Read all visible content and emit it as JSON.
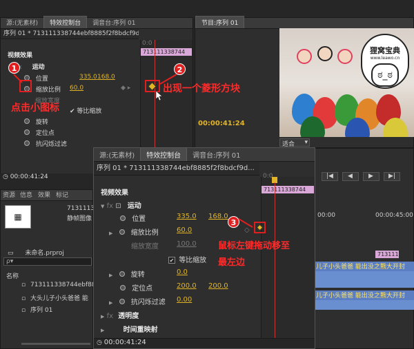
{
  "back_panel": {
    "tabs": [
      "源:(无素材)",
      "特效控制台",
      "调音台:序列 01"
    ],
    "sequence_header": "序列 01 * 713111338744ebf8885f2f8bdcf9d...",
    "section_title": "视频效果",
    "motion": "运动",
    "position_label": "位置",
    "position_x": "335.0",
    "position_y": "168.0",
    "scale_label": "缩放比例",
    "scale_value": "60.0",
    "scale_width_label": "缩放宽度",
    "uniform_scale": "等比缩放",
    "rotation_label": "旋转",
    "anchor_label": "定位点",
    "anti_flicker_label": "抗闪烁过滤",
    "clip_name": "713111338744",
    "timecode": "00:00:41:24",
    "ruler_start": "0:0"
  },
  "program_monitor": {
    "tabs": [
      "节目:序列 01"
    ],
    "timecode": "00:00:41:24",
    "fit_label": "适合",
    "watermark_title": "狸窝宝典",
    "watermark_url": "www.leawo.cn"
  },
  "project_panel": {
    "tabs": [
      "资源",
      "信息",
      "效果",
      "标记"
    ],
    "clip_name": "713111338744",
    "clip_type": "静帧图像",
    "project_file": "未命名.prproj",
    "search_placeholder": "ρ▾",
    "column_name": "名称",
    "items": [
      "713111338744ebf8885f2",
      "大头儿子小头爸爸 能",
      "序列 01"
    ]
  },
  "front_panel": {
    "tabs": [
      "源:(无素材)",
      "特效控制台",
      "调音台:序列 01"
    ],
    "sequence_header": "序列 01 * 713111338744ebf8885f2f8bdcf9d...",
    "section_title": "视频效果",
    "motion": "运动",
    "position_label": "位置",
    "position_x": "335.0",
    "position_y": "168.0",
    "scale_label": "缩放比例",
    "scale_value": "60.0",
    "scale_width_label": "缩放宽度",
    "scale_width_value": "100.0",
    "uniform_scale": "等比缩放",
    "rotation_label": "旋转",
    "rotation_value": "0.0",
    "anchor_label": "定位点",
    "anchor_x": "200.0",
    "anchor_y": "200.0",
    "anti_flicker_label": "抗闪烁过滤",
    "anti_flicker_value": "0.00",
    "opacity_label": "透明度",
    "time_remap_label": "时间重映射",
    "clip_name": "713111338744",
    "timecode": "00:00:41:24",
    "ruler_start": "0:0"
  },
  "timeline": {
    "time_a": "00:00",
    "time_b": "00:00:45:00",
    "clip_name": "713111",
    "track_label": "儿子小头爸爸 能出没之熊大开封"
  },
  "annotations": {
    "step1": "1",
    "step1_text": "点击小图标",
    "step2": "2",
    "step2_text": "出现一个菱形方块",
    "step3": "3",
    "step3_text_line1": "鼠标左键拖动移至",
    "step3_text_line2": "最左边"
  },
  "colors": {
    "accent": "#e3b526",
    "annotation": "#e02020",
    "clip": "#d9a8d9",
    "track": "#5b7ec2"
  }
}
